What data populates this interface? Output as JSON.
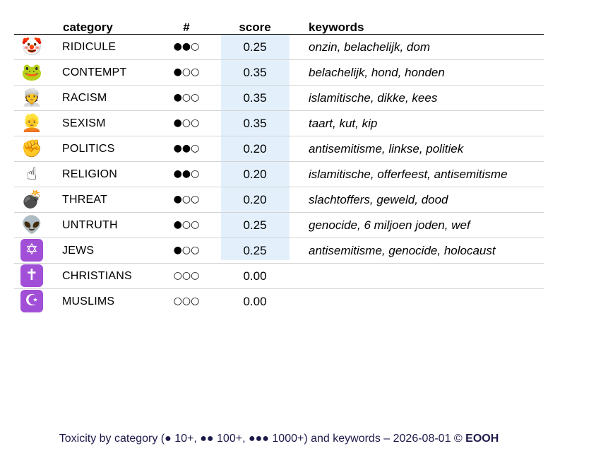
{
  "headers": {
    "category": "category",
    "count": "#",
    "score": "score",
    "keywords": "keywords"
  },
  "rows": [
    {
      "icon": "🤡",
      "icon_name": "clown-face-icon",
      "category": "RIDICULE",
      "count": "●●○",
      "score": "0.25",
      "keywords": "onzin, belachelijk, dom"
    },
    {
      "icon": "🐸",
      "icon_name": "frog-icon",
      "category": "CONTEMPT",
      "count": "●○○",
      "score": "0.35",
      "keywords": "belachelijk, hond, honden"
    },
    {
      "icon": "👳",
      "icon_name": "person-wearing-turban-icon",
      "category": "RACISM",
      "count": "●○○",
      "score": "0.35",
      "keywords": "islamitische, dikke, kees"
    },
    {
      "icon": "👱",
      "icon_name": "blond-woman-icon",
      "category": "SEXISM",
      "count": "●○○",
      "score": "0.35",
      "keywords": "taart, kut, kip"
    },
    {
      "icon": "✊",
      "icon_name": "raised-fist-icon",
      "category": "POLITICS",
      "count": "●●○",
      "score": "0.20",
      "keywords": "antisemitisme, linkse, politiek"
    },
    {
      "icon": "☝",
      "icon_name": "index-pointing-up-icon",
      "category": "RELIGION",
      "count": "●●○",
      "score": "0.20",
      "keywords": "islamitische, offerfeest, antisemitisme"
    },
    {
      "icon": "💣",
      "icon_name": "bomb-icon",
      "category": "THREAT",
      "count": "●○○",
      "score": "0.20",
      "keywords": "slachtoffers, geweld, dood"
    },
    {
      "icon": "👽",
      "icon_name": "alien-icon",
      "category": "UNTRUTH",
      "count": "●○○",
      "score": "0.25",
      "keywords": "genocide, 6 miljoen joden, wef"
    },
    {
      "icon": "✡",
      "icon_name": "star-of-david-icon",
      "category": "JEWS",
      "count": "●○○",
      "score": "0.25",
      "keywords": "antisemitisme, genocide, holocaust"
    },
    {
      "icon": "✝",
      "icon_name": "latin-cross-icon",
      "category": "CHRISTIANS",
      "count": "○○○",
      "score": "0.00",
      "keywords": ""
    },
    {
      "icon": "☪",
      "icon_name": "star-and-crescent-icon",
      "category": "MUSLIMS",
      "count": "○○○",
      "score": "0.00",
      "keywords": ""
    }
  ],
  "caption": {
    "text": "Toxicity by category (● 10+, ●● 100+, ●●● 1000+) and keywords – 2026-08-01 © ",
    "brand": "EOOH"
  },
  "colors": {
    "score_highlight": "#e3f0fc",
    "religion_icon_bg": "#a24fd8",
    "caption_text": "#1d1a4b"
  }
}
